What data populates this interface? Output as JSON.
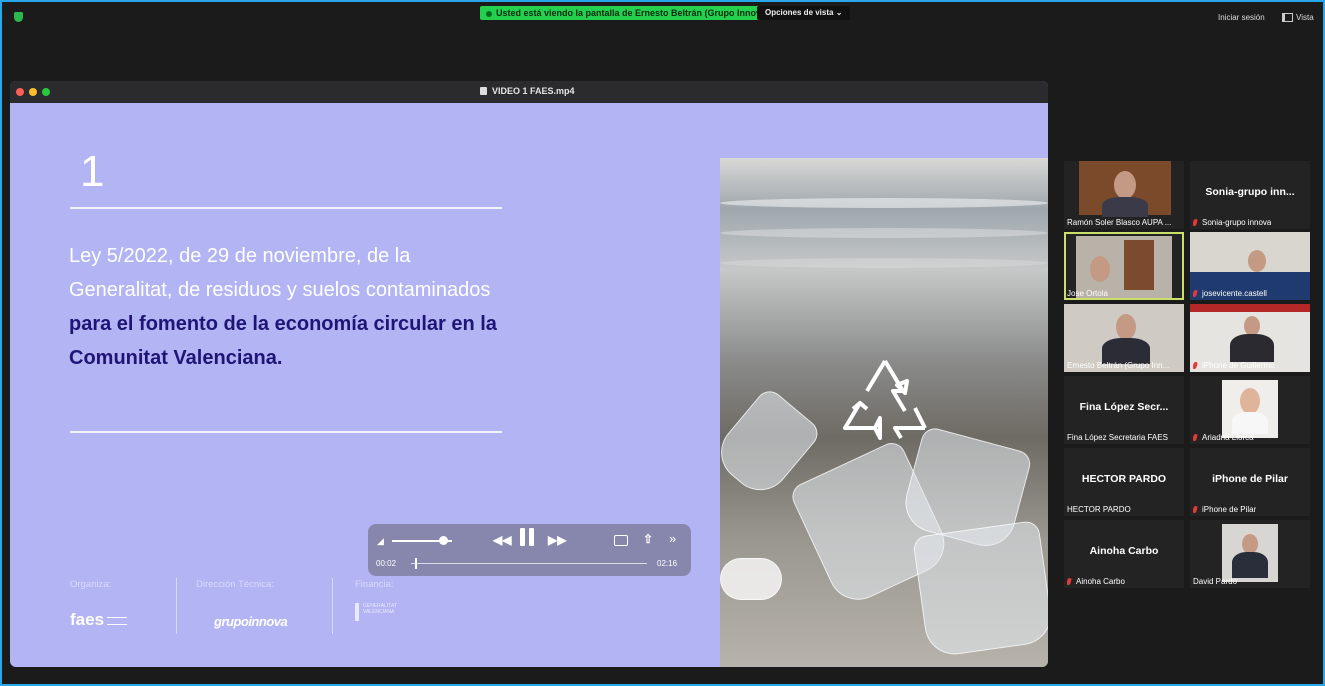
{
  "topbar": {
    "share_banner": "Usted está viendo la pantalla de Ernesto Beltrán (Grupo Innova)",
    "view_options": "Opciones de vista",
    "sign_in": "Iniciar sesión",
    "view": "Vista"
  },
  "player": {
    "file_name": "VIDEO 1 FAES.mp4",
    "slide": {
      "number": "1",
      "law_text": "Ley 5/2022, de 29 de noviembre, de la Generalitat, de residuos y suelos contaminados ",
      "law_bold": "para el fomento de la economía circular en la Comunitat Valenciana.",
      "footer": {
        "organiza": "Organiza:",
        "direccion": "Dirección Técnica:",
        "financia": "Financia:",
        "faes_logo": "faes",
        "innova_logo": "grupoinnova",
        "gva_logo": "GENERALITAT VALENCIANA"
      }
    },
    "controls": {
      "current_time": "00:02",
      "end_time": "02:16",
      "volume_level": 0.85,
      "progress_fraction": 0.015
    }
  },
  "participants": [
    {
      "name": "Ramón Soler Blasco AUPA ...",
      "video": true,
      "muted": false,
      "active": false
    },
    {
      "name": "Sonia-grupo innova",
      "label": "Sonia-grupo  inn...",
      "video": false,
      "muted": true,
      "active": false
    },
    {
      "name": "Jose Ortola",
      "video": true,
      "muted": false,
      "active": true
    },
    {
      "name": "josevicente.castell",
      "video": true,
      "muted": true,
      "active": false
    },
    {
      "name": "Ernesto Beltrán (Grupo Inn...",
      "video": true,
      "muted": false,
      "active": false
    },
    {
      "name": "iPhone de Guillermo",
      "video": true,
      "muted": true,
      "active": false
    },
    {
      "name": "Fina López Secretaria FAES",
      "label": "Fina López Secr...",
      "video": false,
      "muted": false,
      "active": false
    },
    {
      "name": "Ariadna Llorca",
      "video": true,
      "muted": true,
      "active": false
    },
    {
      "name": "HECTOR PARDO",
      "label": "HECTOR PARDO",
      "video": false,
      "muted": false,
      "active": false
    },
    {
      "name": "iPhone de Pilar",
      "label": "iPhone de Pilar",
      "video": false,
      "muted": true,
      "active": false
    },
    {
      "name": "Ainoha Carbo",
      "label": "Ainoha Carbo",
      "video": false,
      "muted": true,
      "active": false
    },
    {
      "name": "David Pardo",
      "video": true,
      "muted": false,
      "active": false
    }
  ],
  "colors": {
    "frame_border": "#28a8e8",
    "slide_background": "#b3b4f4",
    "law_bold": "#1e1576",
    "banner": "#23d14f",
    "active_speaker": "#cbe06a"
  }
}
